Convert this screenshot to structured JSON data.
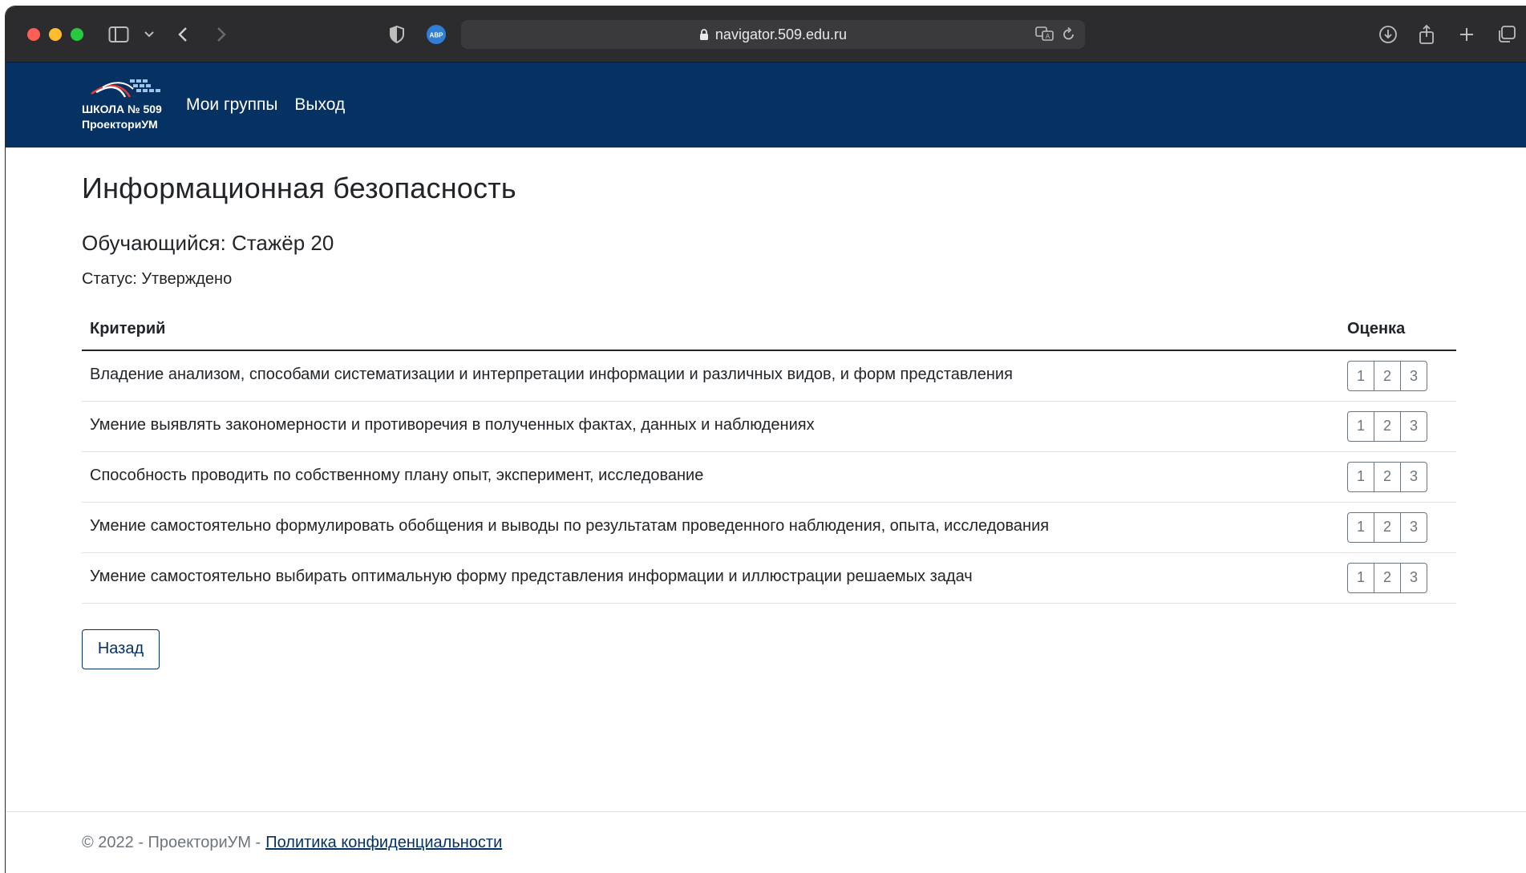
{
  "browser": {
    "url": "navigator.509.edu.ru",
    "adblock_label": "ABP"
  },
  "navbar": {
    "logo_line1": "ШКОЛА № 509",
    "logo_line2": "ПроекториУМ",
    "links": [
      "Мои группы",
      "Выход"
    ]
  },
  "main": {
    "title": "Информационная безопасность",
    "student": "Обучающийся: Стажёр 20",
    "status": "Статус: Утверждено",
    "table": {
      "headers": [
        "Критерий",
        "Оценка"
      ],
      "rows": [
        "Владение анализом, способами систематизации и интерпретации информации и различных видов, и форм представления",
        "Умение выявлять закономерности и противоречия в полученных фактах, данных и наблюдениях",
        "Способность проводить по собственному плану опыт, эксперимент, исследование",
        "Умение самостоятельно формулировать обобщения и выводы по результатам проведенного наблюдения, опыта, исследования",
        "Умение самостоятельно выбирать оптимальную форму представления информации и иллюстрации решаемых задач"
      ],
      "grades": [
        "1",
        "2",
        "3"
      ]
    },
    "back_label": "Назад"
  },
  "footer": {
    "copyright": "© 2022 - ПроекториУМ -",
    "privacy_link": "Политика конфиденциальности"
  },
  "colors": {
    "navbar": "#063163",
    "chrome": "#2c2c2e"
  }
}
